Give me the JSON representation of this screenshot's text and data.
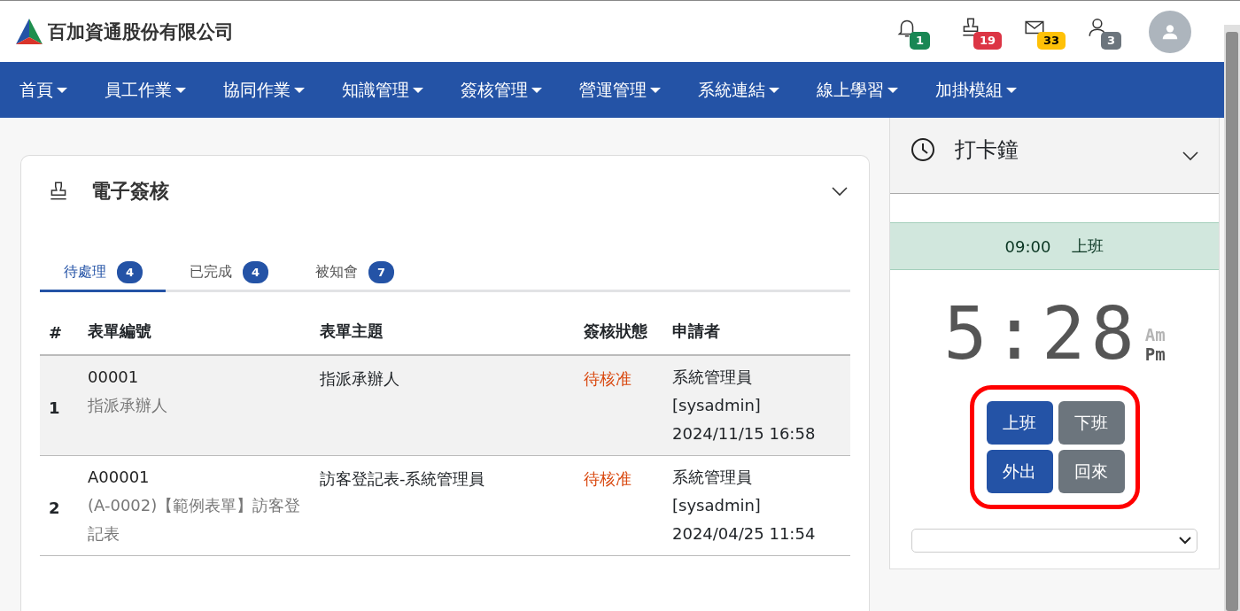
{
  "header": {
    "company": "百加資通股份有限公司",
    "notifications": [
      {
        "kind": "bell",
        "count": "1",
        "color": "#198754"
      },
      {
        "kind": "stamp",
        "count": "19",
        "color": "#dc3545"
      },
      {
        "kind": "mail",
        "count": "33",
        "color": "#ffc107"
      },
      {
        "kind": "user",
        "count": "3",
        "color": "#6c757d"
      }
    ]
  },
  "nav": [
    "首頁",
    "員工作業",
    "協同作業",
    "知識管理",
    "簽核管理",
    "營運管理",
    "系統連結",
    "線上學習",
    "加掛模組"
  ],
  "approval": {
    "title": "電子簽核",
    "tabs": [
      {
        "label": "待處理",
        "count": "4",
        "selected": true
      },
      {
        "label": "已完成",
        "count": "4",
        "selected": false
      },
      {
        "label": "被知會",
        "count": "7",
        "selected": false
      }
    ],
    "columns": [
      "#",
      "表單編號",
      "表單主題",
      "簽核狀態",
      "申請者"
    ],
    "rows": [
      {
        "index": "1",
        "form_no": "00001",
        "form_name": "指派承辦人",
        "subject": "指派承辦人",
        "status": "待核准",
        "applicant": [
          "系統管理員",
          "[sysadmin]",
          "2024/11/15 16:58"
        ]
      },
      {
        "index": "2",
        "form_no": "A00001",
        "form_name": "(A-0002)【範例表單】訪客登記表",
        "subject": "訪客登記表-系統管理員",
        "status": "待核准",
        "applicant": [
          "系統管理員",
          "[sysadmin]",
          "2024/04/25 11:54"
        ]
      }
    ]
  },
  "clock": {
    "title": "打卡鐘",
    "shift": {
      "time": "09:00",
      "label": "上班"
    },
    "display": {
      "time": "5:28",
      "am": "Am",
      "pm": "Pm",
      "pm_selected": true
    },
    "buttons": [
      {
        "label": "上班",
        "kind": "primary"
      },
      {
        "label": "下班",
        "kind": "secondary"
      },
      {
        "label": "外出",
        "kind": "primary"
      },
      {
        "label": "回來",
        "kind": "secondary"
      }
    ]
  }
}
